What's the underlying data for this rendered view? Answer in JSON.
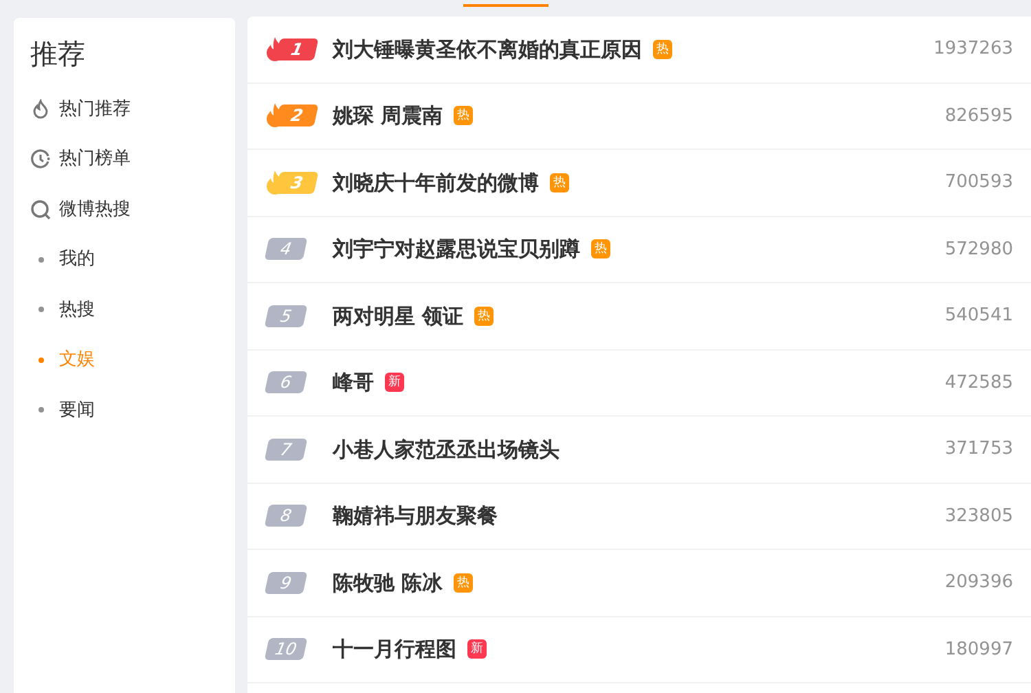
{
  "sidebar": {
    "title": "推荐",
    "items": [
      {
        "label": "热门推荐",
        "kind": "fire",
        "selected": false
      },
      {
        "label": "热门榜单",
        "kind": "clock",
        "selected": false
      },
      {
        "label": "微博热搜",
        "kind": "search",
        "selected": false
      },
      {
        "label": "我的",
        "kind": "sub",
        "selected": false
      },
      {
        "label": "热搜",
        "kind": "sub",
        "selected": false
      },
      {
        "label": "文娱",
        "kind": "sub",
        "selected": true
      },
      {
        "label": "要闻",
        "kind": "sub",
        "selected": false
      }
    ]
  },
  "list": [
    {
      "rank": "1",
      "color": "#f0434b",
      "top": true,
      "title": "刘大锤曝黄圣依不离婚的真正原因",
      "tag": {
        "text": "热",
        "color": "#ff9406"
      },
      "count": "1937263"
    },
    {
      "rank": "2",
      "color": "#ff8a1d",
      "top": true,
      "title": "姚琛 周震南",
      "tag": {
        "text": "热",
        "color": "#ff9406"
      },
      "count": "826595"
    },
    {
      "rank": "3",
      "color": "#ffc53d",
      "top": true,
      "title": "刘晓庆十年前发的微博",
      "tag": {
        "text": "热",
        "color": "#ff9406"
      },
      "count": "700593"
    },
    {
      "rank": "4",
      "color": "#b2b6c4",
      "top": false,
      "title": "刘宇宁对赵露思说宝贝别蹲",
      "tag": {
        "text": "热",
        "color": "#ff9406"
      },
      "count": "572980"
    },
    {
      "rank": "5",
      "color": "#b2b6c4",
      "top": false,
      "title": "两对明星 领证",
      "tag": {
        "text": "热",
        "color": "#ff9406"
      },
      "count": "540541"
    },
    {
      "rank": "6",
      "color": "#b2b6c4",
      "top": false,
      "title": "峰哥",
      "tag": {
        "text": "新",
        "color": "#ff3852"
      },
      "count": "472585"
    },
    {
      "rank": "7",
      "color": "#b2b6c4",
      "top": false,
      "title": "小巷人家范丞丞出场镜头",
      "count": "371753"
    },
    {
      "rank": "8",
      "color": "#b2b6c4",
      "top": false,
      "title": "鞠婧祎与朋友聚餐",
      "count": "323805"
    },
    {
      "rank": "9",
      "color": "#b2b6c4",
      "top": false,
      "title": "陈牧驰 陈冰",
      "tag": {
        "text": "热",
        "color": "#ff9406"
      },
      "count": "209396"
    },
    {
      "rank": "10",
      "color": "#b2b6c4",
      "top": false,
      "title": "十一月行程图",
      "tag": {
        "text": "新",
        "color": "#ff3852"
      },
      "count": "180997"
    }
  ]
}
